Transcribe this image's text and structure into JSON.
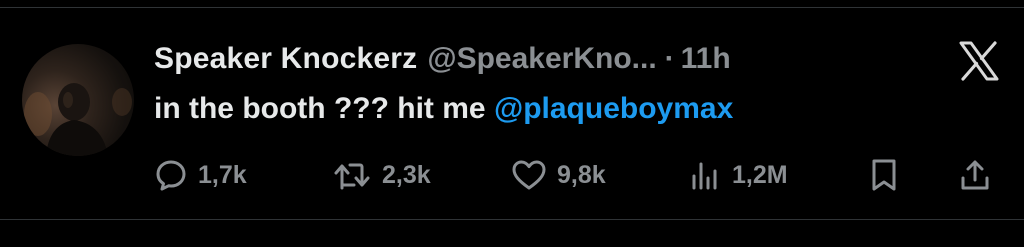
{
  "tweet": {
    "author": {
      "display_name": "Speaker Knockerz",
      "handle": "@SpeakerKno...",
      "avatar_icon": "profile-photo"
    },
    "separator": "·",
    "time_ago": "11h",
    "text_prefix": "in the booth ??? hit me ",
    "mention": "@plaqueboymax",
    "platform_icon": "x-logo-icon"
  },
  "actions": {
    "replies": "1,7k",
    "retweets": "2,3k",
    "likes": "9,8k",
    "views": "1,2M",
    "icons": [
      "reply-icon",
      "retweet-icon",
      "like-icon",
      "views-icon",
      "bookmark-icon",
      "share-icon"
    ]
  },
  "colors": {
    "background": "#000000",
    "text_primary": "#e7e9ea",
    "text_secondary": "#8b8f93",
    "accent": "#1d9bf0",
    "divider": "#2f3336"
  }
}
